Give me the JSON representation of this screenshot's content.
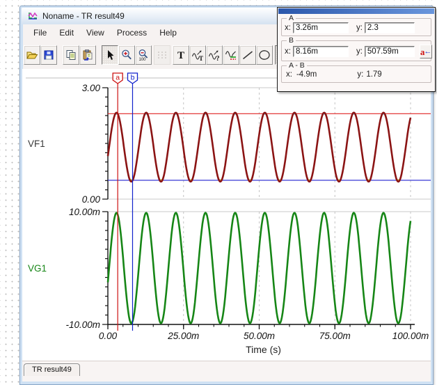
{
  "window": {
    "title": "Noname - TR result49",
    "tab": "TR result49"
  },
  "menu": {
    "items": [
      "File",
      "Edit",
      "View",
      "Process",
      "Help"
    ]
  },
  "toolbar": {
    "buttons": [
      "open",
      "save",
      "copy",
      "paste",
      "select-cursor",
      "zoom-in",
      "zoom-out",
      "grid",
      "text-tool",
      "curve-label",
      "curve-query",
      "curve-legend",
      "line-tool",
      "ellipse-tool",
      "cursor-a-tool"
    ],
    "zoom_out_caption": "100",
    "text_tool_glyph": "T",
    "curve_label_glyph": "T",
    "curve_query_glyph": "?",
    "cursor_tool_glyph": "a"
  },
  "cursor_panel": {
    "a": {
      "label": "A",
      "x_label": "x:",
      "x_value": "3.26m",
      "y_label": "y:",
      "y_value": "2.3"
    },
    "b": {
      "label": "B",
      "x_label": "x:",
      "x_value": "8.16m",
      "y_label": "y:",
      "y_value": "507.59m",
      "button_a": "a",
      "button_arrow": "←"
    },
    "diff": {
      "label": "A - B",
      "x_label": "x:",
      "x_value": "-4.9m",
      "y_label": "y:",
      "y_value": "1.79"
    }
  },
  "chart_data": {
    "type": "line",
    "xlabel": "Time (s)",
    "x_max_ms": 100,
    "x_ticks": [
      {
        "t_ms": 0,
        "label": "0.00"
      },
      {
        "t_ms": 25,
        "label": "25.00m"
      },
      {
        "t_ms": 50,
        "label": "50.00m"
      },
      {
        "t_ms": 75,
        "label": "75.00m"
      },
      {
        "t_ms": 100,
        "label": "100.00m"
      }
    ],
    "minor_x_step_ms": 5,
    "gridline_ts_ms": [
      25,
      50,
      75,
      100
    ],
    "plots": [
      {
        "name": "VF1",
        "label_color": "#3a3a3a",
        "color": "#8b1414",
        "ylim": [
          0,
          3
        ],
        "yticks": [
          {
            "v": 3,
            "label": "3.00"
          },
          {
            "v": 0,
            "label": "0.00"
          }
        ],
        "wave": {
          "offset": 1.4,
          "amplitude": 0.93,
          "period_ms": 9.8,
          "phase_deg": -15
        }
      },
      {
        "name": "VG1",
        "label_color": "#168616",
        "color": "#168616",
        "ylim": [
          -0.01,
          0.01
        ],
        "yticks": [
          {
            "v": 0.01,
            "label": "10.00m"
          },
          {
            "v": -0.01,
            "label": "-10.00m"
          }
        ],
        "wave": {
          "offset": 0,
          "amplitude": 0.0098,
          "period_ms": 9.8,
          "phase_deg": -15
        }
      }
    ],
    "cursors": [
      {
        "id": "a",
        "t_ms": 3.26,
        "color": "#cc1111"
      },
      {
        "id": "b",
        "t_ms": 8.16,
        "color": "#1122cc"
      }
    ],
    "hlines": [
      {
        "plot": 0,
        "v": 2.3,
        "color": "#e02222"
      },
      {
        "plot": 0,
        "v": 0.50759,
        "color": "#2222d0"
      }
    ]
  }
}
